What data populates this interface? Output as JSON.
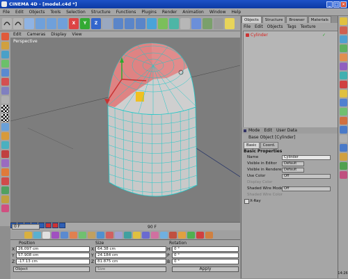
{
  "window": {
    "title": "CINEMA 4D - [model.c4d *]"
  },
  "menubar": [
    "File",
    "Edit",
    "Objects",
    "Tools",
    "Selection",
    "Structure",
    "Functions",
    "Plugins",
    "Render",
    "Animation",
    "Window",
    "Help"
  ],
  "viewport": {
    "menu": [
      "Edit",
      "Cameras",
      "Display",
      "View"
    ],
    "label": "Perspective"
  },
  "timeline": {
    "current_frame": "0 F",
    "end_frame": "90 F"
  },
  "coordinates": {
    "headers": [
      "Position",
      "Size",
      "Rotation"
    ],
    "rows": [
      {
        "axis": "X",
        "position": "26.097 cm",
        "size_axis": "X",
        "size": "64.38 cm",
        "rot_axis": "H",
        "rotation": "0 °"
      },
      {
        "axis": "Y",
        "position": "57.908 cm",
        "size_axis": "Y",
        "size": "24.184 cm",
        "rot_axis": "P",
        "rotation": "0 °"
      },
      {
        "axis": "Z",
        "position": "-17.13 cm",
        "size_axis": "Z",
        "size": "81.875 cm",
        "rot_axis": "B",
        "rotation": "0 °"
      }
    ],
    "mode_select": "Object",
    "size_select": "Size",
    "apply_label": "Apply"
  },
  "object_manager": {
    "tabs": [
      "Objects",
      "Structure",
      "Browser",
      "Materials"
    ],
    "menu": [
      "File",
      "Edit",
      "Objects",
      "Tags",
      "Texture"
    ],
    "items": [
      {
        "name": "Cylinder"
      }
    ]
  },
  "attribute_manager": {
    "menu": [
      "Mode",
      "Edit",
      "User Data"
    ],
    "title": "Base Object [Cylinder]",
    "tabs": [
      "Basic",
      "Coord."
    ],
    "section": "Basic Properties",
    "rows": [
      {
        "label": "Name",
        "value": "Cylinder"
      },
      {
        "label": "Visible in Editor",
        "value": "Default"
      },
      {
        "label": "Visible in Renderer",
        "value": "Default"
      },
      {
        "label": "Use Color",
        "value": "Off"
      },
      {
        "label": "Display Color",
        "value": ""
      },
      {
        "label": "Shaded Wire Mode",
        "value": "Off"
      },
      {
        "label": "Shaded Wire Color",
        "value": ""
      },
      {
        "label": "X-Ray",
        "value": ""
      }
    ]
  },
  "clock": "14:26"
}
